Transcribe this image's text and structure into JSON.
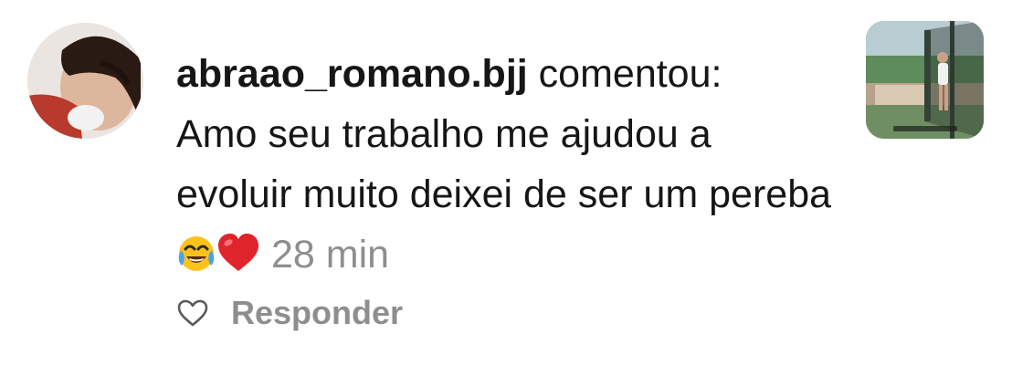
{
  "comment": {
    "username": "abraao_romano.bjj",
    "verb": "comentou:",
    "text": "Amo seu trabalho me ajudou a evoluir muito deixei de ser um pereba",
    "emojis": [
      "face-with-tears-of-joy-icon",
      "red-heart-icon"
    ],
    "time": "28 min",
    "reply_label": "Responder",
    "like_icon": "heart-outline-icon"
  },
  "colors": {
    "text": "#161616",
    "muted": "#8e8e8e",
    "heart": "#e0242c",
    "background": "#ffffff"
  }
}
